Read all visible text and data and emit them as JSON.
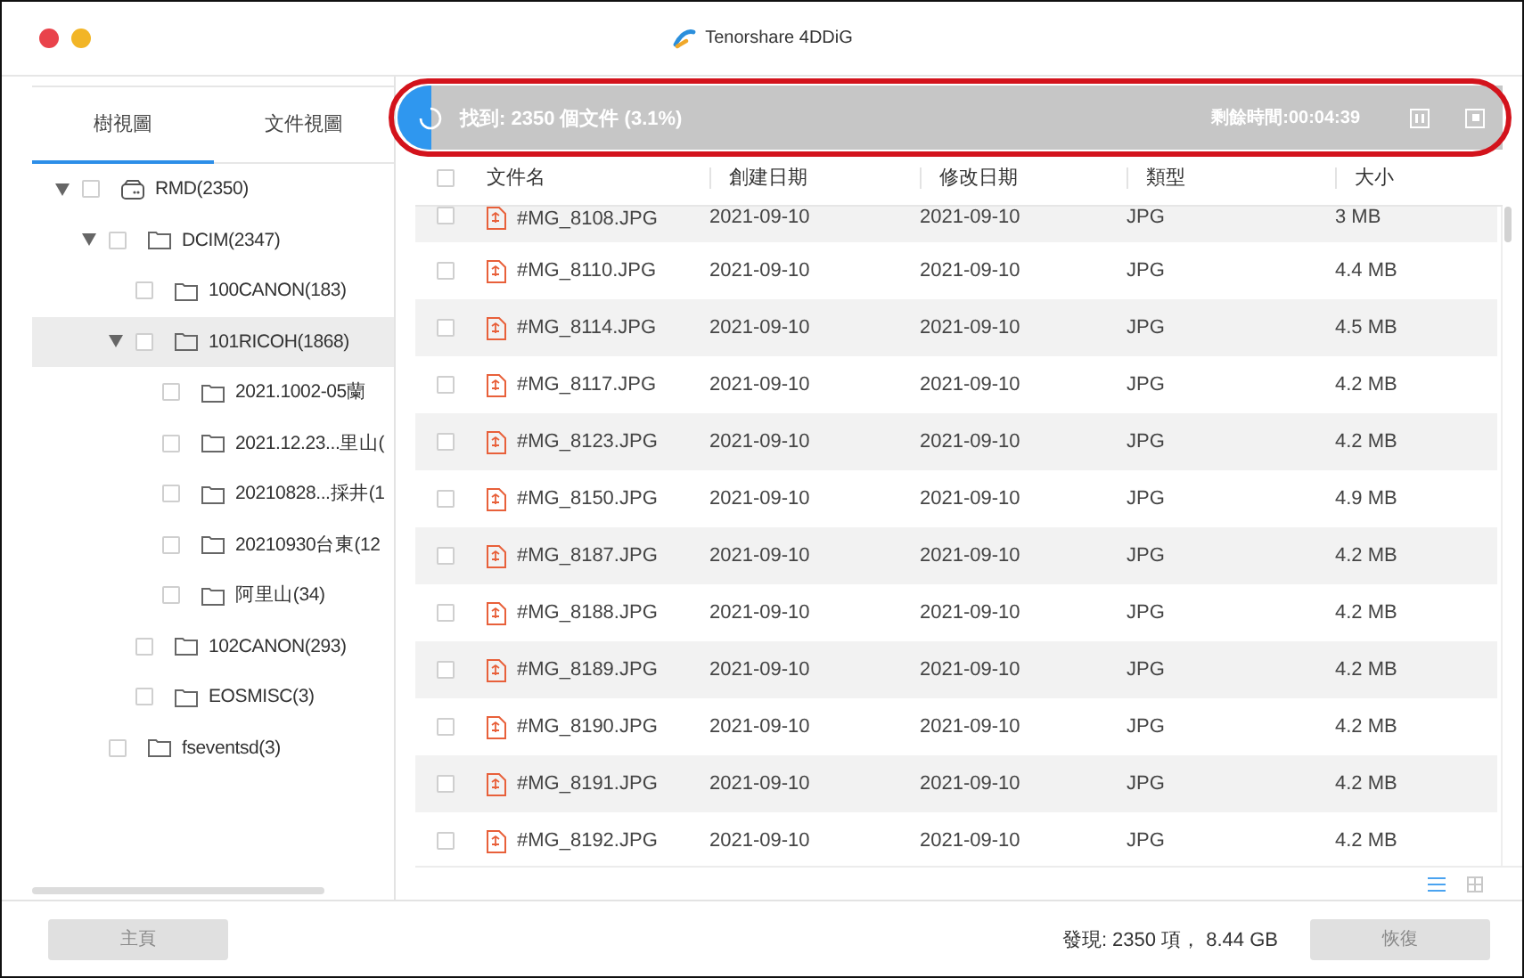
{
  "window": {
    "title": "Tenorshare 4DDiG"
  },
  "sidebar": {
    "tabs": [
      {
        "label": "樹視圖",
        "selected": true
      },
      {
        "label": "文件視圖",
        "selected": false
      }
    ],
    "tree": [
      {
        "label": "RMD(2350)",
        "kind": "drive",
        "expanded": true,
        "checked": false,
        "selected": false,
        "children": [
          {
            "label": "DCIM(2347)",
            "kind": "folder",
            "expanded": true,
            "checked": false,
            "selected": false,
            "children": [
              {
                "label": "100CANON(183)",
                "kind": "folder",
                "checked": false,
                "selected": false
              },
              {
                "label": "101RICOH(1868)",
                "kind": "folder",
                "expanded": true,
                "checked": false,
                "selected": true,
                "children": [
                  {
                    "label": "2021.1002-05蘭",
                    "kind": "folder",
                    "checked": false,
                    "selected": false
                  },
                  {
                    "label": "2021.12.23...里山(",
                    "kind": "folder",
                    "checked": false,
                    "selected": false
                  },
                  {
                    "label": "20210828...採井(1",
                    "kind": "folder",
                    "checked": false,
                    "selected": false
                  },
                  {
                    "label": "20210930台東(12",
                    "kind": "folder",
                    "checked": false,
                    "selected": false
                  },
                  {
                    "label": "阿里山(34)",
                    "kind": "folder",
                    "checked": false,
                    "selected": false
                  }
                ]
              },
              {
                "label": "102CANON(293)",
                "kind": "folder",
                "checked": false,
                "selected": false
              },
              {
                "label": "EOSMISC(3)",
                "kind": "folder",
                "checked": false,
                "selected": false
              }
            ]
          },
          {
            "label": "fseventsd(3)",
            "kind": "folder",
            "checked": false,
            "selected": false
          }
        ]
      }
    ]
  },
  "scan": {
    "status": "找到: 2350 個文件 (3.1%)",
    "level": 0.031,
    "remaining": "剩餘時間:00:04:39",
    "annotated": true
  },
  "table": {
    "select_all_checked": false,
    "columns": [
      "文件名",
      "創建日期",
      "修改日期",
      "類型",
      "大小"
    ],
    "rows": [
      {
        "name": "#MG_8108.JPG",
        "created": "2021-09-10",
        "modified": "2021-09-10",
        "type": "JPG",
        "size": "3 MB",
        "checked": false
      },
      {
        "name": "#MG_8110.JPG",
        "created": "2021-09-10",
        "modified": "2021-09-10",
        "type": "JPG",
        "size": "4.4 MB",
        "checked": false
      },
      {
        "name": "#MG_8114.JPG",
        "created": "2021-09-10",
        "modified": "2021-09-10",
        "type": "JPG",
        "size": "4.5 MB",
        "checked": false
      },
      {
        "name": "#MG_8117.JPG",
        "created": "2021-09-10",
        "modified": "2021-09-10",
        "type": "JPG",
        "size": "4.2 MB",
        "checked": false
      },
      {
        "name": "#MG_8123.JPG",
        "created": "2021-09-10",
        "modified": "2021-09-10",
        "type": "JPG",
        "size": "4.2 MB",
        "checked": false
      },
      {
        "name": "#MG_8150.JPG",
        "created": "2021-09-10",
        "modified": "2021-09-10",
        "type": "JPG",
        "size": "4.9 MB",
        "checked": false
      },
      {
        "name": "#MG_8187.JPG",
        "created": "2021-09-10",
        "modified": "2021-09-10",
        "type": "JPG",
        "size": "4.2 MB",
        "checked": false
      },
      {
        "name": "#MG_8188.JPG",
        "created": "2021-09-10",
        "modified": "2021-09-10",
        "type": "JPG",
        "size": "4.2 MB",
        "checked": false
      },
      {
        "name": "#MG_8189.JPG",
        "created": "2021-09-10",
        "modified": "2021-09-10",
        "type": "JPG",
        "size": "4.2 MB",
        "checked": false
      },
      {
        "name": "#MG_8190.JPG",
        "created": "2021-09-10",
        "modified": "2021-09-10",
        "type": "JPG",
        "size": "4.2 MB",
        "checked": false
      },
      {
        "name": "#MG_8191.JPG",
        "created": "2021-09-10",
        "modified": "2021-09-10",
        "type": "JPG",
        "size": "4.2 MB",
        "checked": false
      },
      {
        "name": "#MG_8192.JPG",
        "created": "2021-09-10",
        "modified": "2021-09-10",
        "type": "JPG",
        "size": "4.2 MB",
        "checked": false
      }
    ]
  },
  "view_toggle": [
    {
      "kind": "list",
      "selected": true
    },
    {
      "kind": "grid",
      "selected": false
    }
  ],
  "footer": {
    "home_button": {
      "label": "主頁",
      "disabled": true
    },
    "summary": "發現: 2350 項， 8.44 GB",
    "recover_button": {
      "label": "恢復",
      "disabled": true
    }
  }
}
